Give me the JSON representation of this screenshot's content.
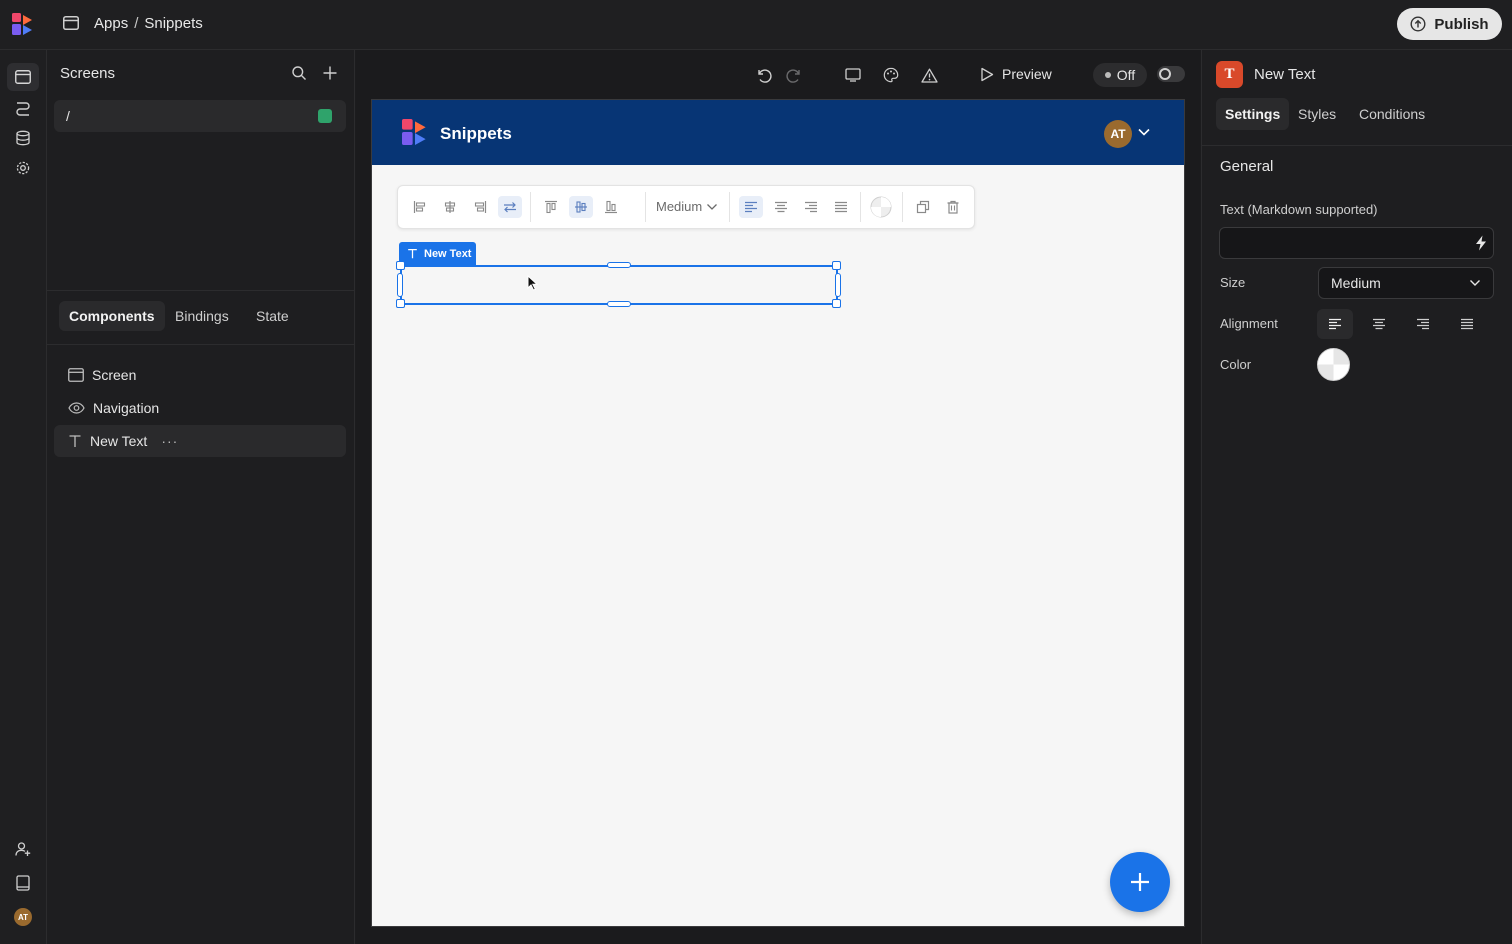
{
  "header": {
    "breadcrumb": [
      "Apps",
      "Snippets"
    ],
    "separator": "/",
    "publish_label": "Publish"
  },
  "left_panel": {
    "screens_title": "Screens",
    "screens": [
      {
        "path": "/",
        "status_color": "#2fa36b"
      }
    ],
    "tabs": [
      "Components",
      "Bindings",
      "State"
    ],
    "active_tab": "Components",
    "tree": [
      {
        "label": "Screen",
        "icon": "screen-icon"
      },
      {
        "label": "Navigation",
        "icon": "eye-icon"
      },
      {
        "label": "New Text",
        "icon": "text-icon",
        "more": "···",
        "selected": true
      }
    ],
    "user_initials": "AT"
  },
  "canvas": {
    "preview_label": "Preview",
    "off_label": "Off",
    "app": {
      "title": "Snippets",
      "avatar_initials": "AT",
      "nav_color": "#073575"
    },
    "toolbar_size": "Medium",
    "selected_badge": "New Text",
    "accent": "#1a73e8"
  },
  "right_panel": {
    "component_icon_letter": "T",
    "component_name": "New Text",
    "tabs": [
      "Settings",
      "Styles",
      "Conditions"
    ],
    "active_tab": "Settings",
    "section": "General",
    "text_label": "Text (Markdown supported)",
    "text_value": "",
    "size_label": "Size",
    "size_value": "Medium",
    "alignment_label": "Alignment",
    "color_label": "Color"
  }
}
